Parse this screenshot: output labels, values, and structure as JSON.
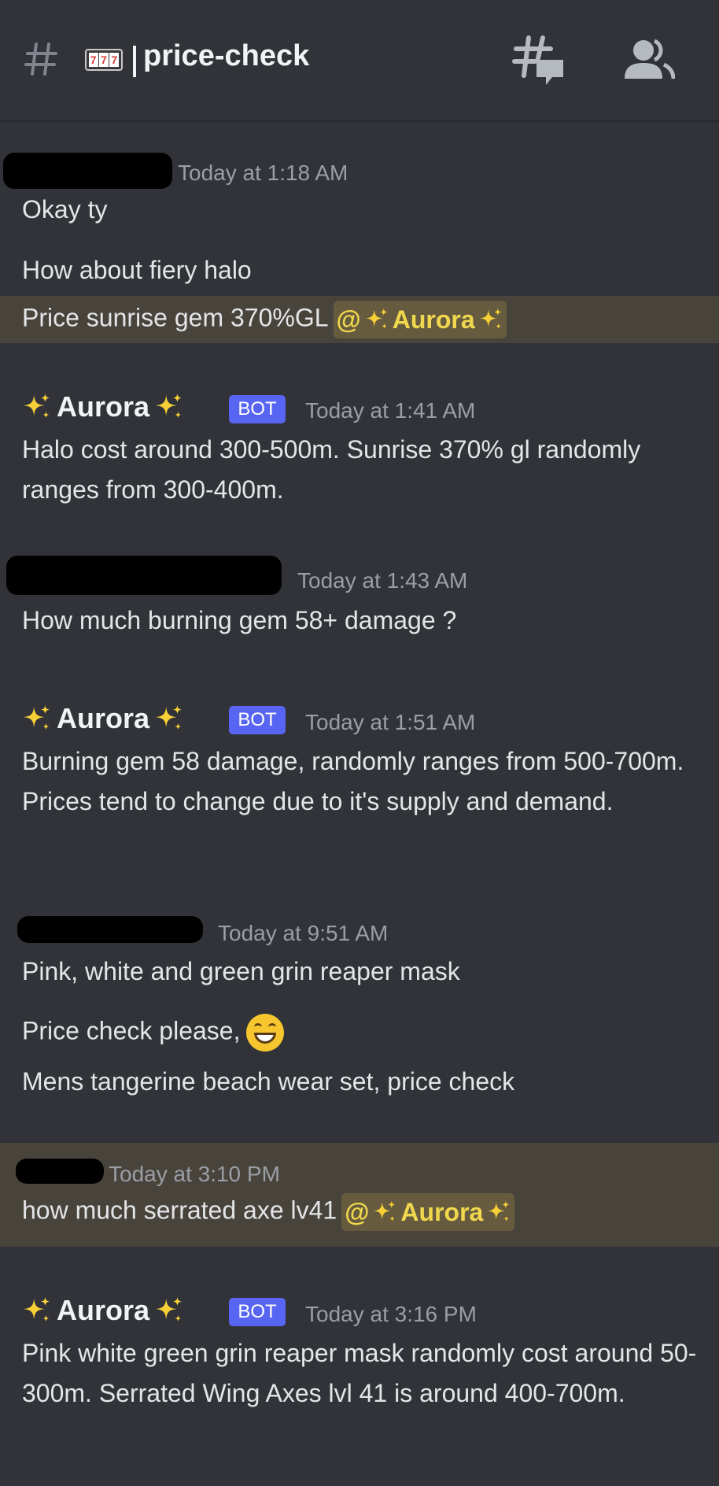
{
  "header": {
    "channel_name": "price-check",
    "channel_emoji": "slot-machine-emoji",
    "icons": [
      "hash-icon",
      "threads-icon",
      "members-icon"
    ]
  },
  "colors": {
    "background": "#313338",
    "highlight": "#48443b",
    "bot_badge": "#5865f2",
    "mention_text": "#f0d84e"
  },
  "messages": [
    {
      "author_redacted": true,
      "timestamp": "Today at 1:18 AM",
      "lines": [
        "Okay ty",
        "How about fiery halo"
      ],
      "mention_line": {
        "text": "Price sunrise gem 370%GL",
        "mention": "@",
        "mention_name": "Aurora"
      }
    },
    {
      "author": "Aurora",
      "badge": "BOT",
      "timestamp": "Today at 1:41 AM",
      "text": "Halo cost around 300-500m. Sunrise 370% gl randomly ranges from 300-400m."
    },
    {
      "author_redacted": true,
      "timestamp": "Today at 1:43 AM",
      "text": "How much burning gem 58+ damage ?"
    },
    {
      "author": "Aurora",
      "badge": "BOT",
      "timestamp": "Today at 1:51 AM",
      "text": "Burning gem 58 damage, randomly ranges from 500-700m. Prices tend to change due to it's supply and demand."
    },
    {
      "author_redacted": true,
      "timestamp": "Today at 9:51 AM",
      "lines": [
        "Pink, white and green grin reaper mask",
        "Price check please,",
        "Mens tangerine beach wear set, price check"
      ]
    },
    {
      "author_redacted": true,
      "timestamp": "Today at 3:10 PM",
      "mention_line": {
        "text": "how much serrated axe lv41",
        "mention": "@",
        "mention_name": "Aurora"
      }
    },
    {
      "author": "Aurora",
      "badge": "BOT",
      "timestamp": "Today at 3:16 PM",
      "text": "Pink white green grin reaper mask randomly cost around 50-300m. Serrated Wing Axes lvl 41 is around 400-700m."
    }
  ]
}
